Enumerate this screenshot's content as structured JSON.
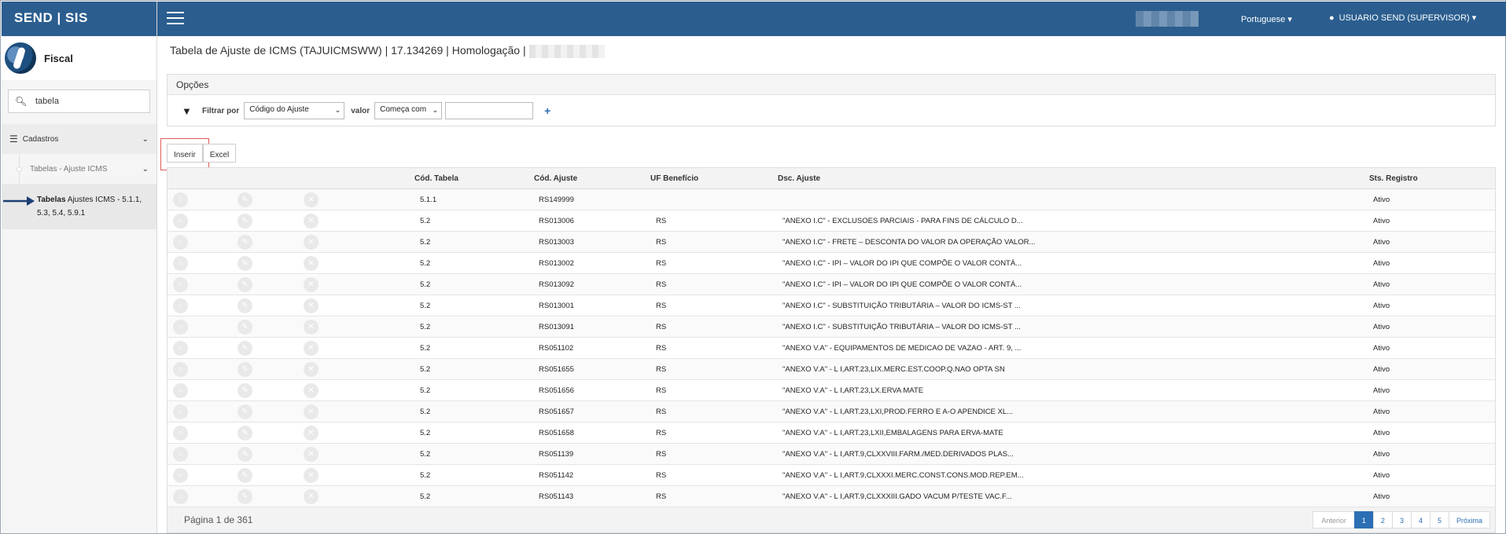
{
  "brand": "SEND | SIS",
  "app": {
    "name": "Fiscal"
  },
  "search": {
    "value": "tabela"
  },
  "sidebar": {
    "group": "Cadastros",
    "submenu": "Tabelas - Ajuste ICMS",
    "active_bold": "Tabelas",
    "active_rest": " Ajustes ICMS - 5.1.1,",
    "active_line2": "5.3, 5.4, 5.9.1"
  },
  "topbar": {
    "language": "Portuguese ▾",
    "user": "USUARIO SEND (SUPERVISOR) ▾"
  },
  "title": "Tabela de Ajuste de ICMS (TAJUICMSWW) | 17.134269 | Homologação |",
  "options": {
    "title": "Opções",
    "filter_label": "Filtrar por",
    "filter_field": "Código do Ajuste",
    "value_label": "valor",
    "operator": "Começa com",
    "value": ""
  },
  "buttons": {
    "insert": "Inserir",
    "excel": "Excel"
  },
  "table": {
    "headers": {
      "cod_tabela": "Cód. Tabela",
      "cod_ajuste": "Cód. Ajuste",
      "uf": "UF Benefício",
      "dsc": "Dsc. Ajuste",
      "sts": "Sts. Registro"
    },
    "rows": [
      {
        "tabela": "5.1.1",
        "ajuste": "RS149999",
        "uf": "",
        "dsc": "",
        "sts": "Ativo"
      },
      {
        "tabela": "5.2",
        "ajuste": "RS013006",
        "uf": "RS",
        "dsc": "\"ANEXO I.C\" - EXCLUSOES PARCIAIS - PARA FINS DE CÁLCULO D...",
        "sts": "Ativo"
      },
      {
        "tabela": "5.2",
        "ajuste": "RS013003",
        "uf": "RS",
        "dsc": "\"ANEXO I.C\" - FRETE – DESCONTA DO VALOR DA OPERAÇÃO VALOR...",
        "sts": "Ativo"
      },
      {
        "tabela": "5.2",
        "ajuste": "RS013002",
        "uf": "RS",
        "dsc": "\"ANEXO I.C\" - IPI – VALOR DO IPI QUE COMPÕE O VALOR CONTÁ...",
        "sts": "Ativo"
      },
      {
        "tabela": "5.2",
        "ajuste": "RS013092",
        "uf": "RS",
        "dsc": "\"ANEXO I.C\" - IPI – VALOR DO IPI QUE COMPÕE O VALOR CONTÁ...",
        "sts": "Ativo"
      },
      {
        "tabela": "5.2",
        "ajuste": "RS013001",
        "uf": "RS",
        "dsc": "\"ANEXO I.C\" - SUBSTITUIÇÃO TRIBUTÁRIA – VALOR DO ICMS-ST ...",
        "sts": "Ativo"
      },
      {
        "tabela": "5.2",
        "ajuste": "RS013091",
        "uf": "RS",
        "dsc": "\"ANEXO I.C\" - SUBSTITUIÇÃO TRIBUTÁRIA – VALOR DO ICMS-ST ...",
        "sts": "Ativo"
      },
      {
        "tabela": "5.2",
        "ajuste": "RS051102",
        "uf": "RS",
        "dsc": "\"ANEXO V.A\" - EQUIPAMENTOS DE MEDICAO DE VAZAO - ART. 9, ...",
        "sts": "Ativo"
      },
      {
        "tabela": "5.2",
        "ajuste": "RS051655",
        "uf": "RS",
        "dsc": "\"ANEXO V.A\" - L I,ART.23,LIX.MERC.EST.COOP.Q.NAO OPTA SN",
        "sts": "Ativo"
      },
      {
        "tabela": "5.2",
        "ajuste": "RS051656",
        "uf": "RS",
        "dsc": "\"ANEXO V.A\" - L I,ART.23,LX.ERVA MATE",
        "sts": "Ativo"
      },
      {
        "tabela": "5.2",
        "ajuste": "RS051657",
        "uf": "RS",
        "dsc": "\"ANEXO V.A\" - L I,ART.23,LXI,PROD.FERRO E A-O APENDICE XL...",
        "sts": "Ativo"
      },
      {
        "tabela": "5.2",
        "ajuste": "RS051658",
        "uf": "RS",
        "dsc": "\"ANEXO V.A\" - L I,ART.23,LXII,EMBALAGENS PARA ERVA-MATE",
        "sts": "Ativo"
      },
      {
        "tabela": "5.2",
        "ajuste": "RS051139",
        "uf": "RS",
        "dsc": "\"ANEXO V.A\" - L I,ART.9,CLXXVIII.FARM./MED.DERIVADOS PLAS...",
        "sts": "Ativo"
      },
      {
        "tabela": "5.2",
        "ajuste": "RS051142",
        "uf": "RS",
        "dsc": "\"ANEXO V.A\" - L I,ART.9,CLXXXI.MERC.CONST.CONS.MOD.REP.EM...",
        "sts": "Ativo"
      },
      {
        "tabela": "5.2",
        "ajuste": "RS051143",
        "uf": "RS",
        "dsc": "\"ANEXO V.A\" - L I,ART.9,CLXXXIII.GADO VACUM P/TESTE VAC.F...",
        "sts": "Ativo"
      }
    ]
  },
  "pagination": {
    "info": "Página 1 de 361",
    "prev": "Anterior",
    "pages": [
      "1",
      "2",
      "3",
      "4",
      "5"
    ],
    "active_page": "1",
    "next": "Próxima"
  },
  "colors": {
    "primary": "#2b5e8f",
    "accent": "#2b6fb5",
    "highlight": "#e05a5a"
  }
}
